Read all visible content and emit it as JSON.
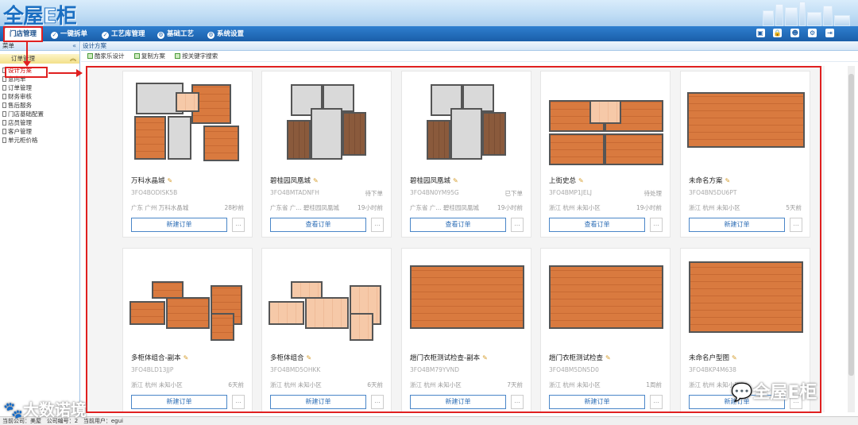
{
  "app": {
    "logo_text": "全屋",
    "logo_e": "E",
    "logo_tail": "柜"
  },
  "nav": {
    "active": "门店管理",
    "items": [
      "一键拆单",
      "工艺库管理",
      "基础工艺",
      "系统设置"
    ]
  },
  "sidebar": {
    "header": "菜单",
    "section": "订单管理",
    "items": [
      "设计方案",
      "意向单",
      "订单管理",
      "财务审核",
      "售后服务",
      "门店基础配置",
      "店员管理",
      "客户管理",
      "单元柜价格"
    ]
  },
  "content": {
    "tab": "设计方案",
    "toolbar": [
      "酷家乐设计",
      "复制方案",
      "按关键字搜索"
    ]
  },
  "cards": [
    {
      "name": "万科水晶城",
      "code": "3FO4BODISK5B",
      "status": "",
      "loc": "广东 广州 万科水晶城",
      "time": "28秒前",
      "button": "新建订单",
      "more": "..."
    },
    {
      "name": "碧桂园凤凰城",
      "code": "3FO4BMTADNFH",
      "status": "待下单",
      "loc": "广东省 广... 碧桂园凤凰城",
      "time": "19小时前",
      "button": "查看订单",
      "more": "..."
    },
    {
      "name": "碧桂园凤凰城",
      "code": "3FO4BN0YM95G",
      "status": "已下单",
      "loc": "广东省 广... 碧桂园凤凰城",
      "time": "19小时前",
      "button": "查看订单",
      "more": "..."
    },
    {
      "name": "上街史总",
      "code": "3FO4BMP1JELJ",
      "status": "待处理",
      "loc": "浙江 杭州 未知小区",
      "time": "19小时前",
      "button": "查看订单",
      "more": "..."
    },
    {
      "name": "未命名方案",
      "code": "3FO4BN5DU6PT",
      "status": "",
      "loc": "浙江 杭州 未知小区",
      "time": "5天前",
      "button": "新建订单",
      "more": "..."
    },
    {
      "name": "多柜体组合-副本",
      "code": "3FO4BLD13JJP",
      "status": "",
      "loc": "浙江 杭州 未知小区",
      "time": "6天前",
      "button": "新建订单",
      "more": "..."
    },
    {
      "name": "多柜体组合",
      "code": "3FO4BMD5OHKK",
      "status": "",
      "loc": "浙江 杭州 未知小区",
      "time": "6天前",
      "button": "新建订单",
      "more": "..."
    },
    {
      "name": "趟门衣柜测试检查-副本",
      "code": "3FO4BM79YVND",
      "status": "",
      "loc": "浙江 杭州 未知小区",
      "time": "7天前",
      "button": "新建订单",
      "more": "..."
    },
    {
      "name": "趟门衣柜测试检查",
      "code": "3FO4BM5DN5D0",
      "status": "",
      "loc": "浙江 杭州 未知小区",
      "time": "1周前",
      "button": "新建订单",
      "more": "..."
    },
    {
      "name": "未命名户型图",
      "code": "3FO4BKP4M638",
      "status": "",
      "loc": "浙江 杭州 未知小区",
      "time": "",
      "button": "新建订单",
      "more": "..."
    }
  ],
  "footer": {
    "company_label": "当前公司：",
    "company": "美屋",
    "code_label": "公司编号：",
    "code": "2",
    "user_label": "当前用户：",
    "user": "egui"
  },
  "watermarks": {
    "left": "大数诺境",
    "right": "全屋E柜"
  },
  "colors": {
    "nav_blue": "#1a5ea8",
    "annotation_red": "#e02020",
    "button_blue": "#2b6cb5",
    "floor_orange": "#d9773b"
  }
}
